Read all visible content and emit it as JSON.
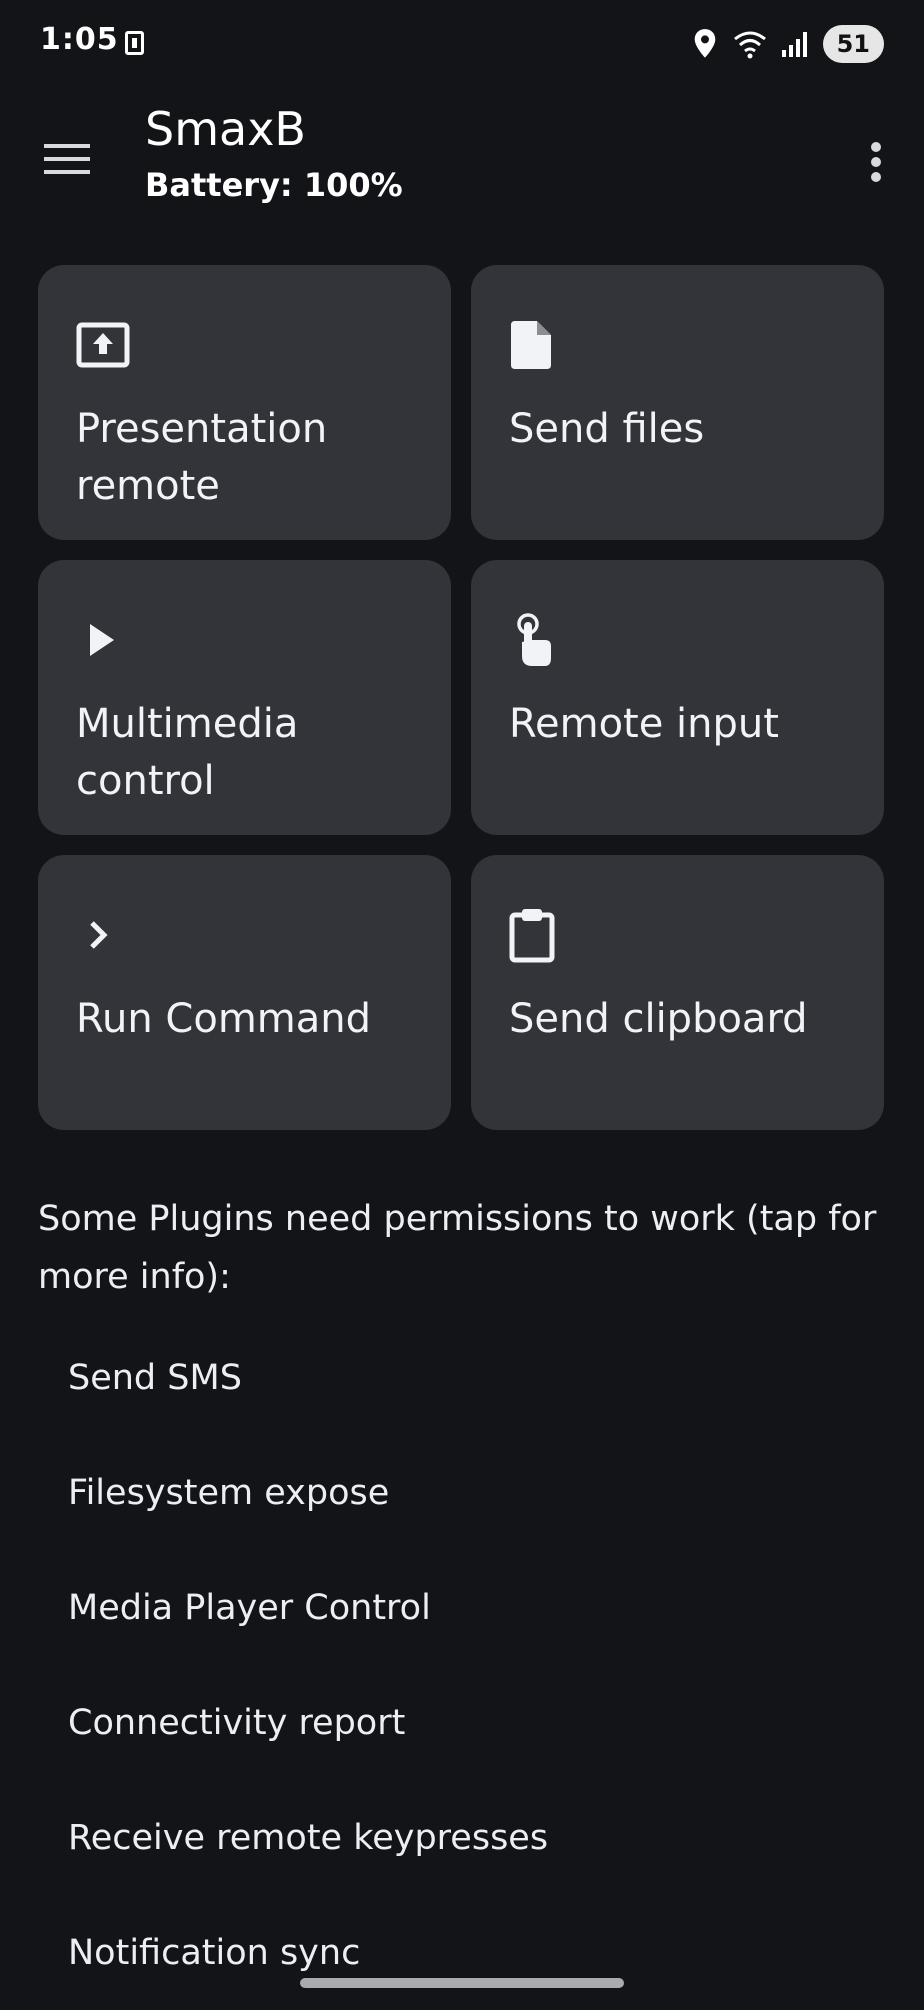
{
  "status_bar": {
    "time": "1:05",
    "battery": "51",
    "icons": [
      "sim-icon",
      "location-icon",
      "wifi-icon",
      "signal-icon"
    ]
  },
  "app_bar": {
    "title": "SmaxB",
    "subtitle": "Battery: 100%",
    "icons": [
      "menu-icon",
      "more-vert-icon"
    ]
  },
  "plugins": [
    {
      "label": "Presentation remote",
      "icon": "presentation-upload-icon"
    },
    {
      "label": "Send files",
      "icon": "file-icon"
    },
    {
      "label": "Multimedia control",
      "icon": "play-icon"
    },
    {
      "label": "Remote input",
      "icon": "touch-icon"
    },
    {
      "label": "Run Command",
      "icon": "chevron-right-icon"
    },
    {
      "label": "Send clipboard",
      "icon": "clipboard-icon"
    }
  ],
  "permissions": {
    "note": "Some Plugins need permissions to work (tap for more info):",
    "items": [
      "Send SMS",
      "Filesystem expose",
      "Media Player Control",
      "Connectivity report",
      "Receive remote keypresses",
      "Notification sync"
    ]
  },
  "colors": {
    "background": "#131418",
    "card": "#33343a",
    "text": "#eef0f4"
  }
}
